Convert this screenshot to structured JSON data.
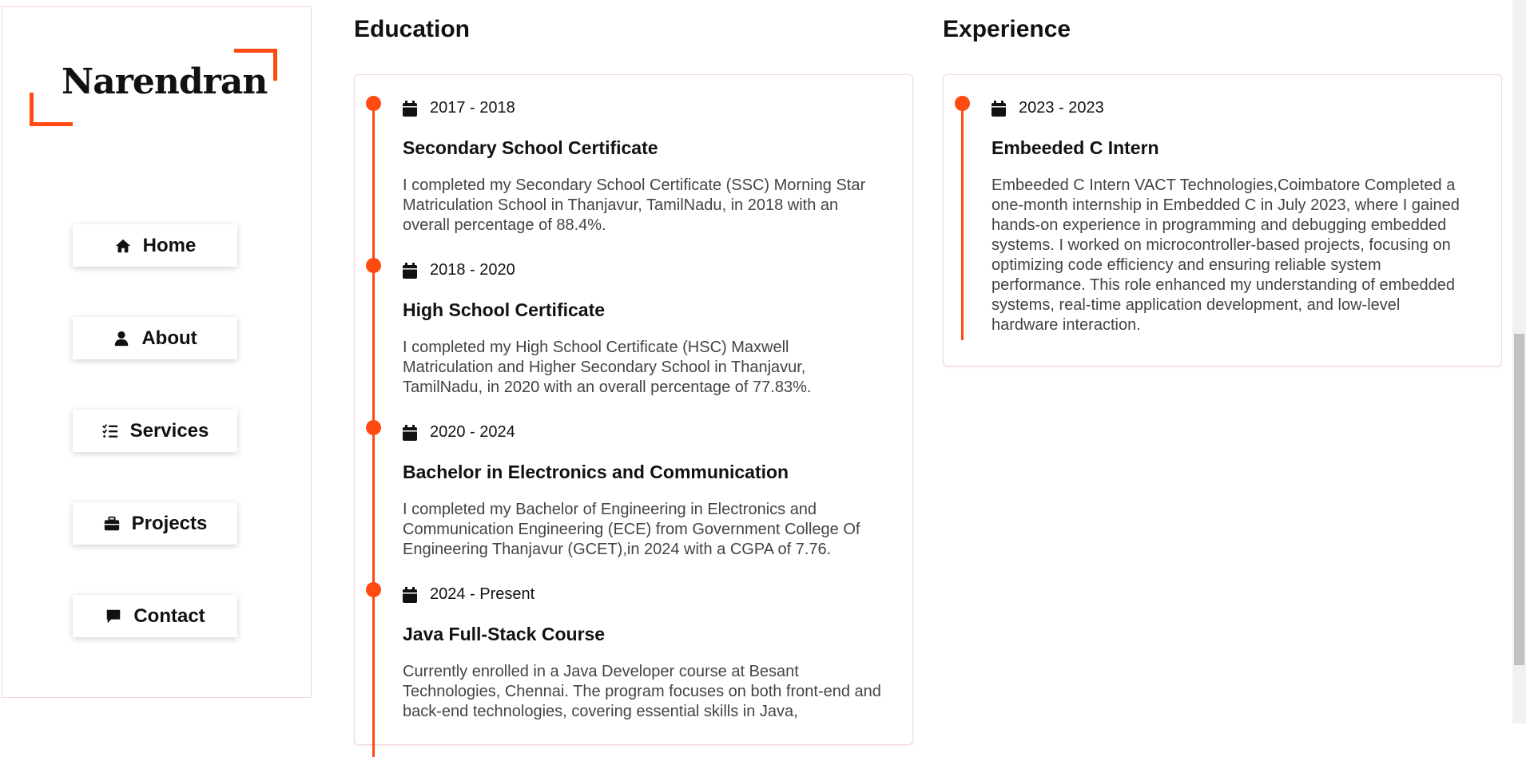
{
  "sidebar": {
    "logo_name": "Narendran",
    "nav": [
      {
        "label": "Home",
        "icon": "home-icon"
      },
      {
        "label": "About",
        "icon": "user-icon"
      },
      {
        "label": "Services",
        "icon": "list-check-icon"
      },
      {
        "label": "Projects",
        "icon": "briefcase-icon"
      },
      {
        "label": "Contact",
        "icon": "message-icon"
      }
    ]
  },
  "education": {
    "title": "Education",
    "entries": [
      {
        "date": "2017 - 2018",
        "title": "Secondary School Certificate",
        "desc": "I completed my Secondary School Certificate (SSC) Morning Star Matriculation School in Thanjavur, TamilNadu, in 2018 with an overall percentage of 88.4%."
      },
      {
        "date": "2018 - 2020",
        "title": "High School Certificate",
        "desc": "I completed my High School Certificate (HSC) Maxwell Matriculation and Higher Secondary School in Thanjavur, TamilNadu, in 2020 with an overall percentage of 77.83%."
      },
      {
        "date": "2020 - 2024",
        "title": "Bachelor in Electronics and Communication",
        "desc": "I completed my Bachelor of Engineering in Electronics and Communication Engineering (ECE) from Government College Of Engineering Thanjavur (GCET),in 2024 with a CGPA of 7.76."
      },
      {
        "date": "2024 - Present",
        "title": "Java Full-Stack Course",
        "desc": "Currently enrolled in a Java Developer course at Besant Technologies, Chennai. The program focuses on both front-end and back-end technologies, covering essential skills in Java,"
      }
    ]
  },
  "experience": {
    "title": "Experience",
    "entries": [
      {
        "date": "2023 - 2023",
        "title": "Embeeded C Intern",
        "desc": "Embeeded C Intern VACT Technologies,Coimbatore Completed a one-month internship in Embedded C in July 2023, where I gained hands-on experience in programming and debugging embedded systems. I worked on microcontroller-based projects, focusing on optimizing code efficiency and ensuring reliable system performance. This role enhanced my understanding of embedded systems, real-time application development, and low-level hardware interaction."
      }
    ]
  },
  "colors": {
    "accent": "#ff4a11",
    "card_border": "#f3d4dc",
    "text": "#111111",
    "muted_text": "#444444"
  }
}
